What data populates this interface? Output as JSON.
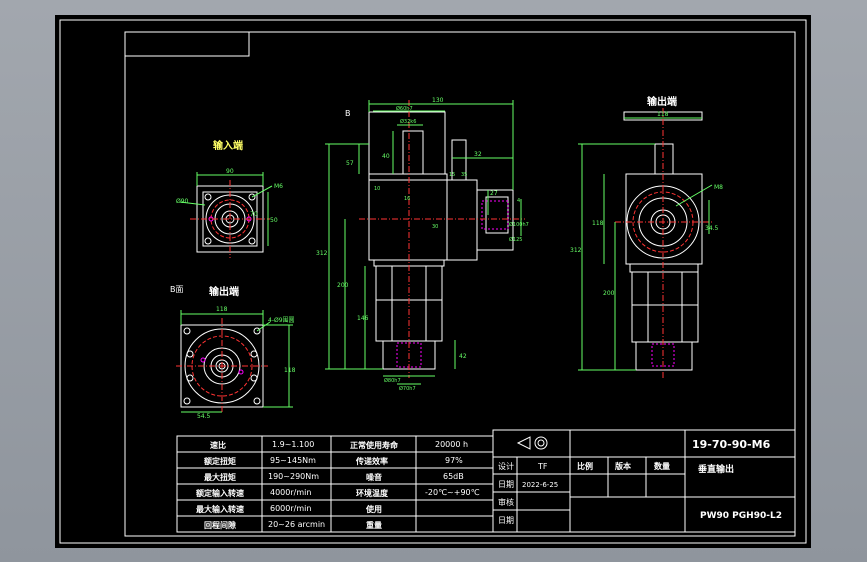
{
  "colors": {
    "background": "#000000",
    "frame": "#ffffff",
    "outline": "#ffffff",
    "dimension": "#66ff66",
    "centerline": "#ff3333",
    "hidden": "#ff00ff",
    "note": "#ffff66"
  },
  "views": {
    "input_end_title": "输入端",
    "output_end_title_left": "输出端",
    "output_end_title_right": "输出端",
    "section_b": "B面",
    "b_marker": "B"
  },
  "dims": {
    "in_90_top": "90",
    "in_m6": "M6",
    "in_d90": "Ø90",
    "in_50": "50",
    "in_70": "70",
    "out_118_top": "118",
    "out_4holes": "4-Ø9围圆",
    "out_118_side": "118",
    "out_54": "54.5",
    "front_130": "130",
    "front_d60": "Ø60h7",
    "front_d32": "Ø32k6",
    "front_40": "40",
    "front_57": "57",
    "front_15": "15",
    "front_32": "32",
    "front_35": "35",
    "front_10": "10",
    "front_4": "4",
    "front_27": "27",
    "front_16": "16",
    "front_30": "30",
    "front_d100": "Ø100h7",
    "front_d125": "Ø125",
    "front_312": "312",
    "front_200": "200",
    "front_146": "146",
    "front_42": "42",
    "front_d80": "Ø80h7",
    "front_d70": "Ø70h7",
    "right_118": "118",
    "right_m8": "M8",
    "right_312": "312",
    "right_118_side": "118",
    "right_200": "200",
    "right_345": "34.5"
  },
  "spec_table": {
    "rows": [
      {
        "label1": "速比",
        "value1": "1.9~1.100",
        "label2": "正常使用寿命",
        "value2": "20000 h"
      },
      {
        "label1": "额定扭矩",
        "value1": "95~145Nm",
        "label2": "传递效率",
        "value2": "97%"
      },
      {
        "label1": "最大扭矩",
        "value1": "190~290Nm",
        "label2": "噪音",
        "value2": "65dB"
      },
      {
        "label1": "额定输入转速",
        "value1": "4000r/min",
        "label2": "环境温度",
        "value2": "-20℃~+90℃"
      },
      {
        "label1": "最大输入转速",
        "value1": "6000r/min",
        "label2": "使用",
        "value2": ""
      },
      {
        "label1": "回程间隙",
        "value1": "20~26 arcmin",
        "label2": "重量",
        "value2": ""
      }
    ]
  },
  "title_block": {
    "design_label": "设计",
    "designer": "TF",
    "scale_label": "比例",
    "version_label": "版本",
    "quantity_label": "数量",
    "date_label": "日期",
    "date": "2022-6-25",
    "review_label": "审核",
    "date_label2": "日期",
    "drawing_no": "19-70-90-M6",
    "drawing_name": "垂直输出",
    "model": "PW90 PGH90-L2"
  }
}
